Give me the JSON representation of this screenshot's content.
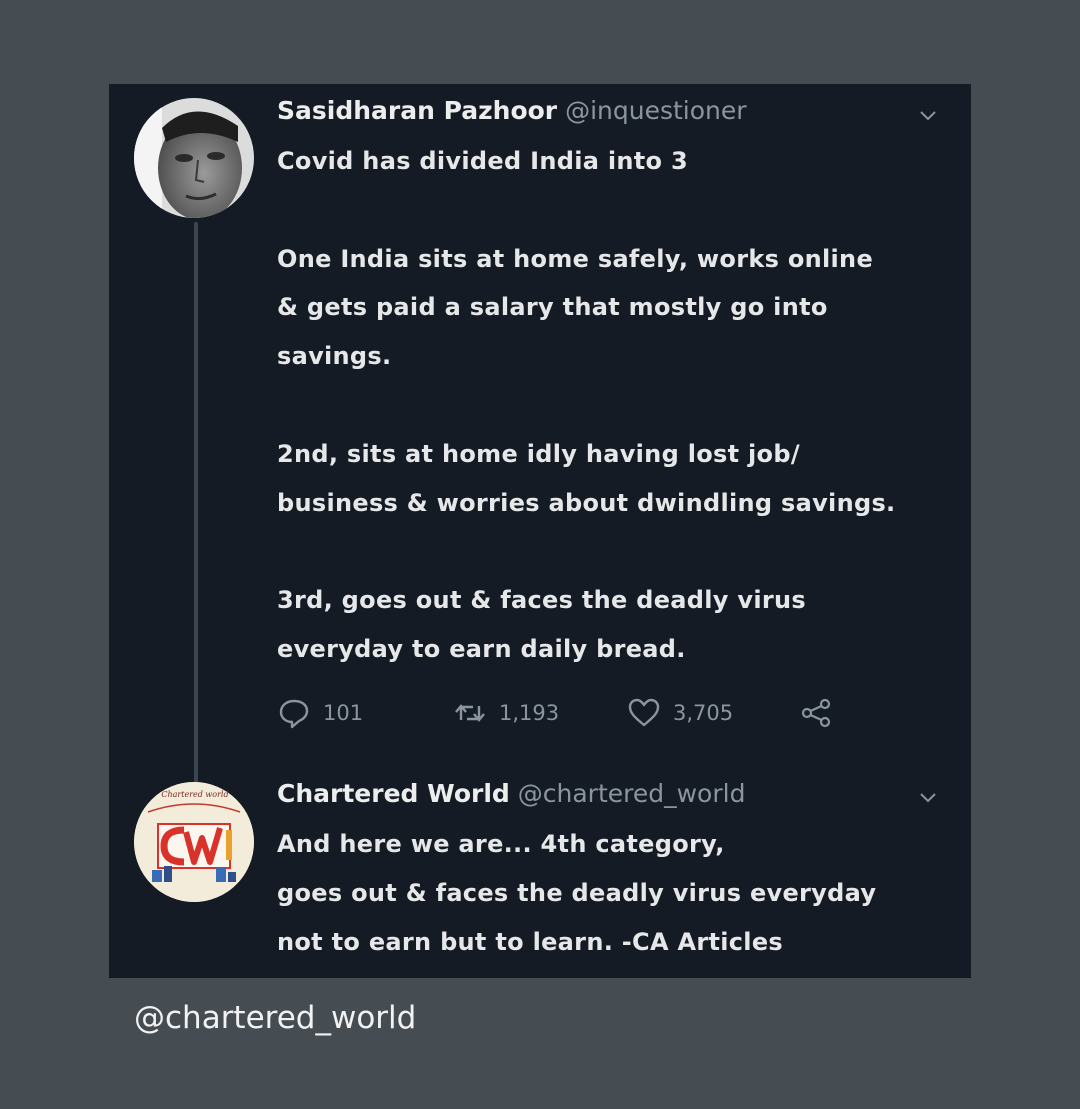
{
  "tweet1": {
    "name": "Sasidharan Pazhoor",
    "handle": "@inquestioner",
    "text": "Covid has divided India into 3\n\nOne India sits at home safely, works online\n& gets paid a  salary that mostly go into\nsavings.\n\n2nd, sits at home idly having lost job/\nbusiness & worries about dwindling savings.\n\n3rd, goes out & faces the deadly virus\neveryday to earn daily bread.",
    "actions": {
      "replies": "101",
      "retweets": "1,193",
      "likes": "3,705"
    }
  },
  "tweet2": {
    "name": "Chartered World",
    "handle": "@chartered_world",
    "text": "And here we are... 4th category,\ngoes out & faces the deadly virus everyday\nnot to earn but to learn. -CA Articles",
    "avatar_logo": {
      "top_text": "Chartered world",
      "letters": "CW"
    }
  },
  "footer": {
    "handle": "@chartered_world"
  },
  "colors": {
    "background": "#454d53",
    "card": "#141b24",
    "text": "#e6e7e8",
    "muted": "#8b959e",
    "logo_red": "#d8322b"
  },
  "icons": {
    "reply": "reply-icon",
    "retweet": "retweet-icon",
    "like": "heart-icon",
    "share": "share-icon",
    "menu": "chevron-down-icon"
  }
}
